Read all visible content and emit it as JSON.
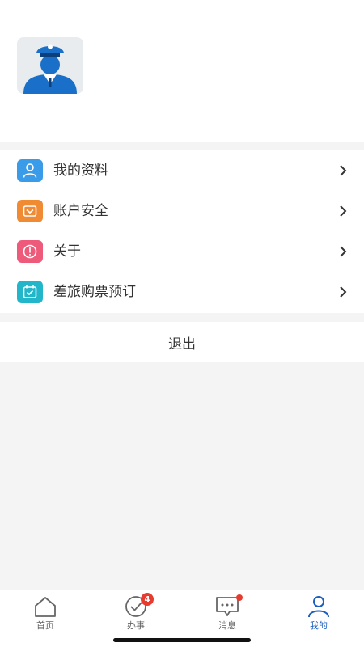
{
  "profile": {
    "name": "",
    "detail": ""
  },
  "menu": {
    "items": [
      {
        "label": "我的资料",
        "icon": "user-icon",
        "color": "#3a9be8"
      },
      {
        "label": "账户安全",
        "icon": "shield-icon",
        "color": "#f08a33"
      },
      {
        "label": "关于",
        "icon": "alert-icon",
        "color": "#ee5b7a"
      },
      {
        "label": "差旅购票预订",
        "icon": "calendar-check-icon",
        "color": "#21b6c9"
      }
    ]
  },
  "logout": {
    "label": "退出"
  },
  "tabbar": {
    "tabs": [
      {
        "label": "首页",
        "icon": "home-icon",
        "active": false
      },
      {
        "label": "办事",
        "icon": "check-circle-icon",
        "active": false,
        "badge": "4"
      },
      {
        "label": "消息",
        "icon": "message-icon",
        "active": false,
        "dot": true
      },
      {
        "label": "我的",
        "icon": "person-icon",
        "active": true
      }
    ]
  },
  "colors": {
    "active_tab": "#1c5fbf",
    "badge": "#e63b2e",
    "background": "#f4f4f4"
  }
}
